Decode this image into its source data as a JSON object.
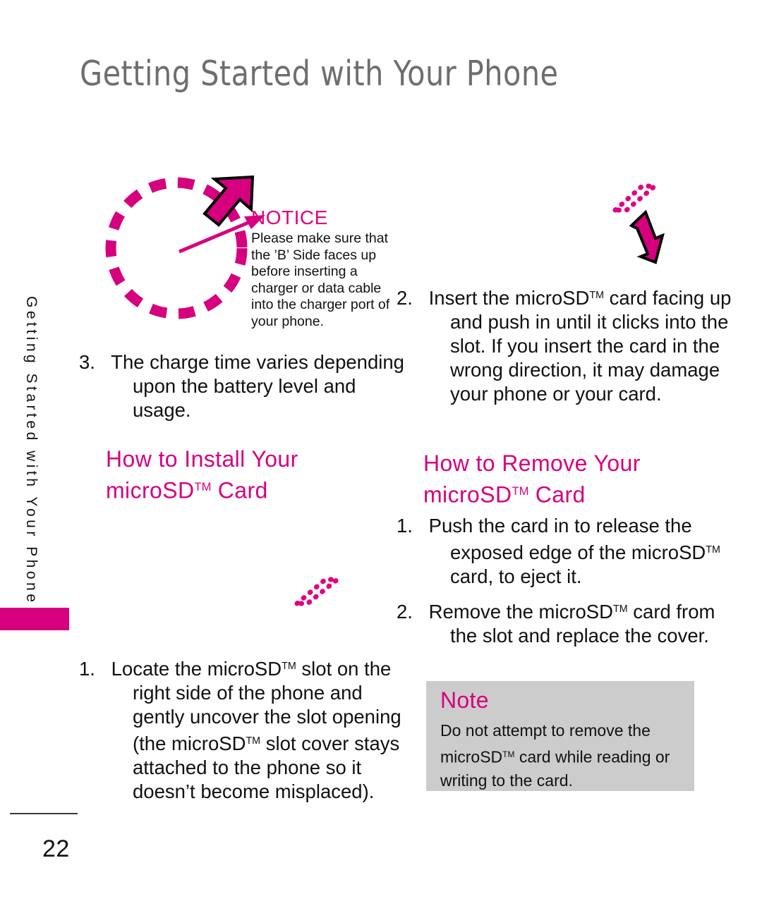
{
  "page": {
    "title": "Getting Started with Your Phone",
    "sidebar_label": "Getting Started with Your Phone",
    "page_number": "22",
    "accent_color": "#d6007f",
    "title_color": "#6e6e6e",
    "note_box_color": "#cccccc"
  },
  "notice": {
    "title": "NOTICE",
    "body": "Please make sure that the ’B’ Side faces up before inserting a charger or data cable into the charger port of your phone."
  },
  "left_column": {
    "step3_number": "3.",
    "step3_text": "The charge time varies depending upon the battery level and usage.",
    "heading_line1": "How to Install Your",
    "heading_line2_pre": "microSD",
    "heading_line2_tm": "TM",
    "heading_line2_post": " Card",
    "step1_number": "1.",
    "step1_text_a": "Locate the microSD",
    "step1_tm_a": "TM",
    "step1_text_b": " slot on the right side of the phone and gently uncover the slot opening (the microSD",
    "step1_tm_b": "TM",
    "step1_text_c": " slot cover stays attached to the phone so it doesn’t become misplaced)."
  },
  "right_column": {
    "step2_number": "2.",
    "step2_text_a": "Insert the microSD",
    "step2_tm": "TM",
    "step2_text_b": " card facing up and push in until it clicks into the slot. If you insert the card in the wrong direction, it may damage your phone or your card.",
    "heading_line1": "How to Remove Your",
    "heading_line2_pre": "microSD",
    "heading_line2_tm": "TM",
    "heading_line2_post": " Card",
    "step1_number": "1.",
    "step1_text_a": "Push the card in to release the exposed edge of the microSD",
    "step1_tm": "TM",
    "step1_text_b": " card, to eject it.",
    "step2b_number": "2.",
    "step2b_text_a": "Remove the microSD",
    "step2b_tm": "TM",
    "step2b_text_b": " card from the slot and replace the cover."
  },
  "note": {
    "title": "Note",
    "body_a": "Do not attempt to remove the microSD",
    "body_tm": "TM",
    "body_b": " card while reading or writing to the card."
  },
  "graphics": {
    "dashed_circle": "dashed-circle-charger-port",
    "big_arrow": "pointer-arrow-up-right",
    "thin_arrow": "thin-callout-arrow",
    "dotted_card_left": "dotted-microsd-card-outline",
    "dotted_card_right": "dotted-microsd-card-outline",
    "insert_arrow": "insert-arrow-up-left"
  }
}
